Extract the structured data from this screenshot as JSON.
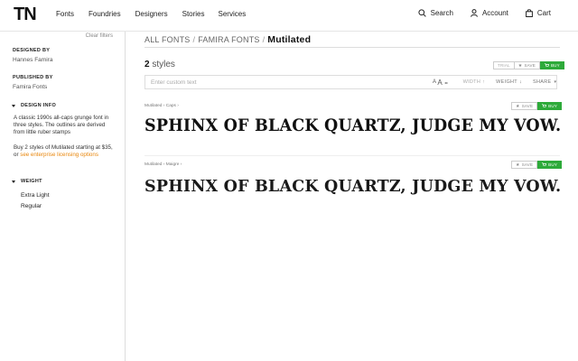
{
  "header": {
    "logo": "TN",
    "nav": [
      "Fonts",
      "Foundries",
      "Designers",
      "Stories",
      "Services"
    ],
    "search_label": "Search",
    "account_label": "Account",
    "cart_label": "Cart"
  },
  "sidebar": {
    "clear_filters": "Clear filters",
    "designed_by_label": "DESIGNED BY",
    "designed_by_value": "Hannes Famira",
    "published_by_label": "PUBLISHED BY",
    "published_by_value": "Famira Fonts",
    "design_info_label": "DESIGN INFO",
    "design_info_text": "A classic 1990s all-caps grunge font in three styles. The outlines are derived from little ruber stamps",
    "buy_text": "Buy 2 styles of Mutilated starting at $35, or ",
    "licensing_link": "see enterprise licensing options",
    "weight_label": "WEIGHT",
    "weights": [
      "Extra Light",
      "Regular"
    ]
  },
  "main": {
    "breadcrumb": [
      "ALL FONTS",
      "FAMIRA FONTS"
    ],
    "breadcrumb_current": "Mutilated",
    "styles_count": "2",
    "styles_word": "styles",
    "top_buttons": {
      "trial": "TRIAL",
      "save": "SAVE",
      "buy": "BUY"
    },
    "toolbar": {
      "placeholder": "Enter custom text",
      "size_small": "A",
      "size_large": "A",
      "width": "WIDTH",
      "weight": "WEIGHT",
      "share": "SHARE"
    },
    "styles": [
      {
        "family": "Mutilated",
        "style": "Caps",
        "save": "SAVE",
        "buy": "BUY",
        "sample": "SPHINX OF BLACK QUARTZ, JUDGE MY VOW."
      },
      {
        "family": "Mutilated",
        "style": "Maigre",
        "save": "SAVE",
        "buy": "BUY",
        "sample": "SPHINX OF BLACK QUARTZ, JUDGE MY VOW."
      }
    ]
  },
  "colors": {
    "buy_green": "#2eaa3a",
    "link_orange": "#e8860b"
  }
}
